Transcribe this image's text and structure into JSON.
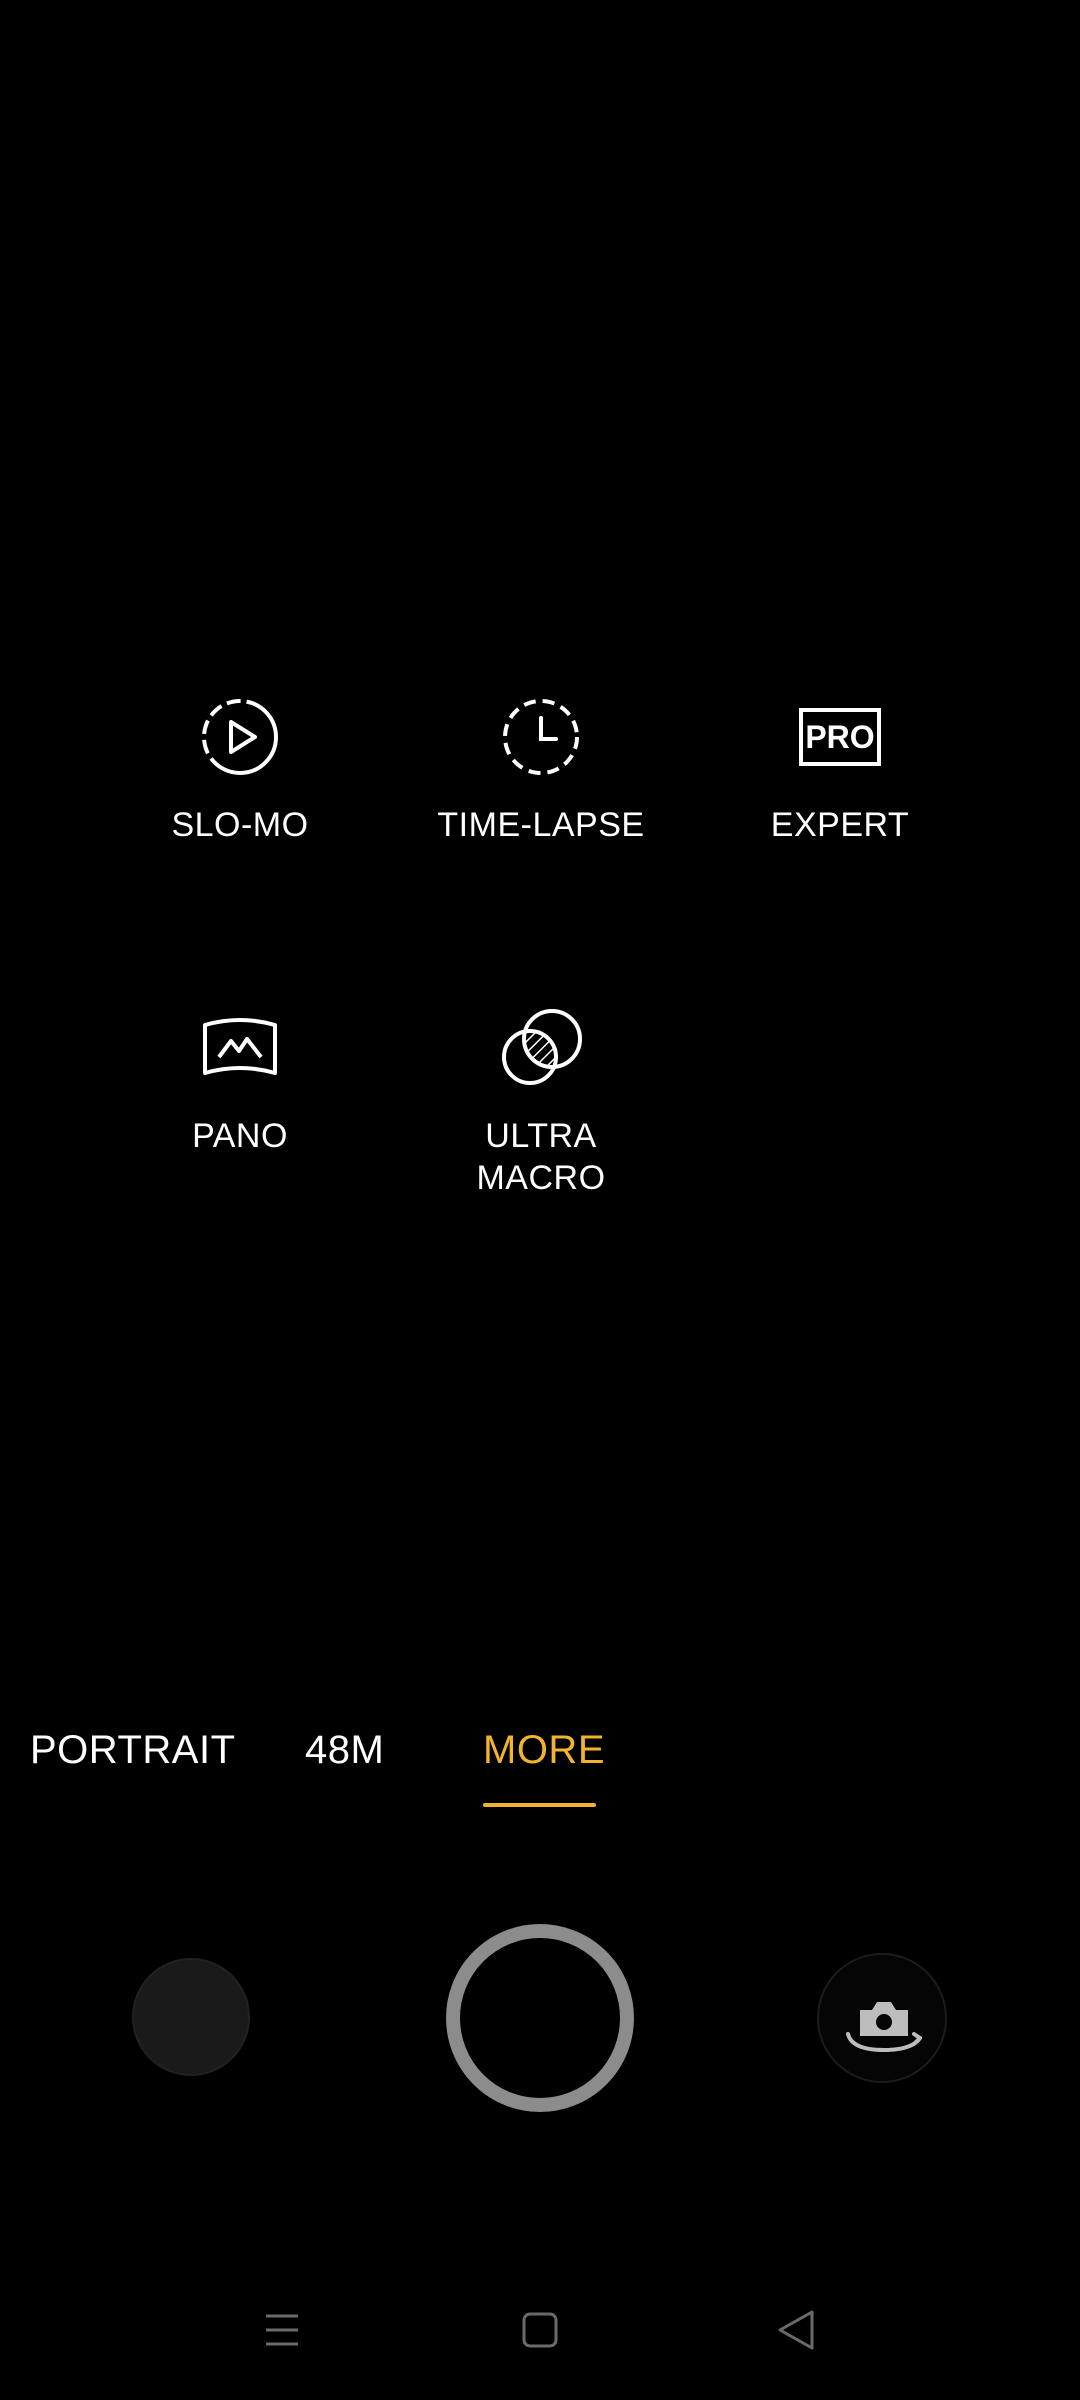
{
  "modes": {
    "slo_mo": "SLO-MO",
    "time_lapse": "TIME-LAPSE",
    "expert": "EXPERT",
    "expert_icon_text": "PRO",
    "pano": "PANO",
    "ultra_macro": "ULTRA\nMACRO"
  },
  "tabs": {
    "portrait": "PORTRAIT",
    "m48": "48M",
    "more": "MORE"
  },
  "colors": {
    "accent": "#f2b42b",
    "shutter_ring": "#8c8c8c",
    "background": "#000000"
  },
  "icons": {
    "slo_mo": "slo-mo-icon",
    "time_lapse": "time-lapse-icon",
    "expert": "pro-icon",
    "pano": "panorama-icon",
    "ultra_macro": "ultra-macro-icon",
    "switch_camera": "switch-camera-icon"
  }
}
